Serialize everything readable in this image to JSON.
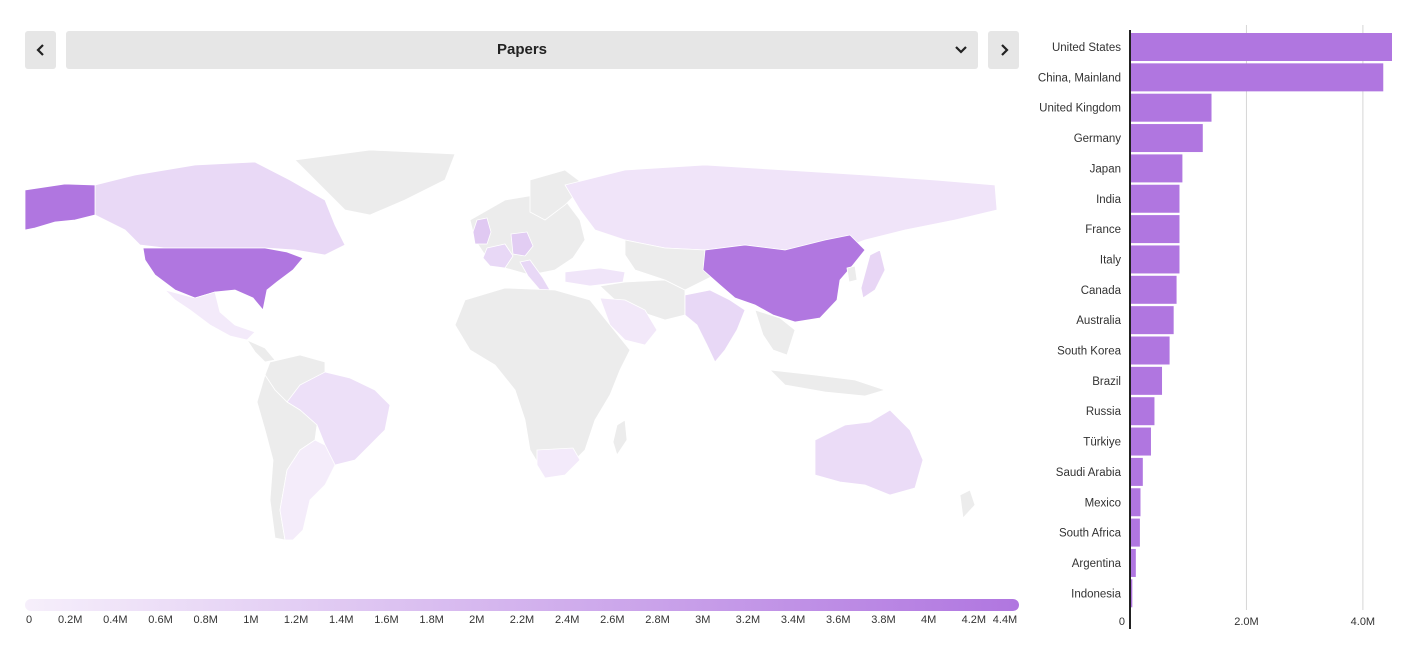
{
  "header": {
    "prev_label": "‹",
    "next_label": "›",
    "selected_metric": "Papers"
  },
  "icons": {
    "prev": "chevron-left-icon",
    "next": "chevron-right-icon",
    "dropdown": "chevron-down-icon"
  },
  "colors": {
    "scale_low": "#f6effb",
    "scale_high": "#b076e0",
    "no_data": "#ececec",
    "bar": "#b076e0"
  },
  "legend": {
    "min": 0,
    "max": 4.4,
    "unit": "M",
    "ticks": [
      "0",
      "0.2M",
      "0.4M",
      "0.6M",
      "0.8M",
      "1M",
      "1.2M",
      "1.4M",
      "1.6M",
      "1.8M",
      "2M",
      "2.2M",
      "2.4M",
      "2.6M",
      "2.8M",
      "3M",
      "3.2M",
      "3.4M",
      "3.6M",
      "3.8M",
      "4M",
      "4.2M",
      "4.4M"
    ]
  },
  "map": {
    "values_millions": {
      "United States": 4.5,
      "China, Mainland": 4.35,
      "Canada": 0.8,
      "Brazil": 0.55,
      "Australia": 0.7,
      "India": 0.85,
      "Russia": 0.4,
      "Mexico": 0.2,
      "Argentina": 0.1,
      "South Africa": 0.2,
      "Japan": 0.9,
      "United Kingdom": 1.4,
      "Germany": 1.25,
      "France": 0.85,
      "Italy": 0.85,
      "Saudi Arabia": 0.25,
      "Türkiye": 0.35
    }
  },
  "chart_data": {
    "type": "bar",
    "orientation": "horizontal",
    "categories": [
      "United States",
      "China, Mainland",
      "United Kingdom",
      "Germany",
      "Japan",
      "India",
      "France",
      "Italy",
      "Canada",
      "Australia",
      "South Korea",
      "Brazil",
      "Russia",
      "Türkiye",
      "Saudi Arabia",
      "Mexico",
      "South Africa",
      "Argentina",
      "Indonesia"
    ],
    "values": [
      4.5,
      4.35,
      1.4,
      1.25,
      0.9,
      0.85,
      0.85,
      0.85,
      0.8,
      0.75,
      0.68,
      0.55,
      0.42,
      0.36,
      0.22,
      0.18,
      0.17,
      0.1,
      0.04
    ],
    "unit": "M",
    "xlim": [
      0,
      4.5
    ],
    "xticks": [
      {
        "value": 0,
        "label": "0"
      },
      {
        "value": 2,
        "label": "2.0M"
      },
      {
        "value": 4,
        "label": "4.0M"
      }
    ],
    "grid": true
  }
}
